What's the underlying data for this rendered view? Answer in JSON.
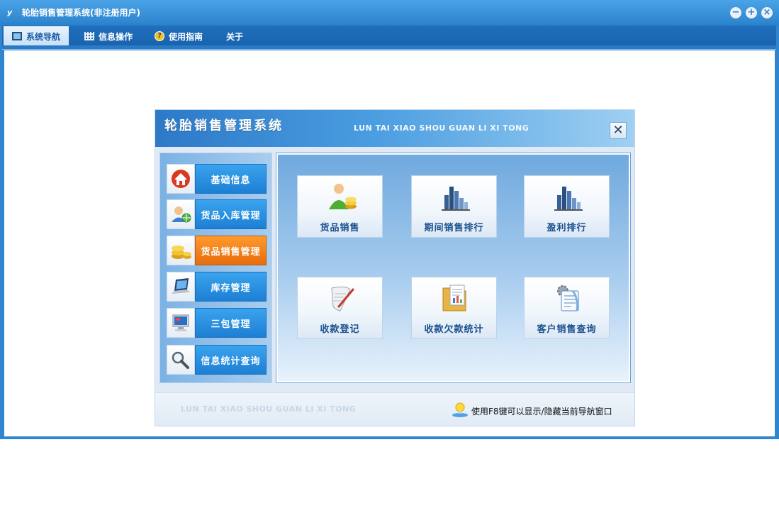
{
  "window": {
    "title": "轮胎销售管理系统(非注册用户)",
    "logo_char": "y",
    "controls": {
      "minimize": "−",
      "restore": "+",
      "close": "×"
    }
  },
  "menu": {
    "tabs": [
      {
        "label": "系统导航",
        "icon": "screen-icon",
        "active": true
      },
      {
        "label": "信息操作",
        "icon": "grid-icon",
        "active": false
      },
      {
        "label": "使用指南",
        "icon": "help-icon",
        "active": false
      },
      {
        "label": "关于",
        "icon": "",
        "active": false
      }
    ]
  },
  "nav": {
    "title": "轮胎销售管理系统",
    "subtitle": "LUN TAI XIAO SHOU GUAN LI XI TONG",
    "close_symbol": "✕",
    "side_items": [
      {
        "label": "基础信息",
        "icon": "home-icon",
        "active": false
      },
      {
        "label": "货品入库管理",
        "icon": "user-network-icon",
        "active": false
      },
      {
        "label": "货品销售管理",
        "icon": "coins-icon",
        "active": true
      },
      {
        "label": "库存管理",
        "icon": "laptop-icon",
        "active": false
      },
      {
        "label": "三包管理",
        "icon": "computer-icon",
        "active": false
      },
      {
        "label": "信息统计查询",
        "icon": "magnifier-icon",
        "active": false
      }
    ],
    "functions": [
      {
        "label": "货品销售",
        "icon": "users-coins-icon"
      },
      {
        "label": "期间销售排行",
        "icon": "bar-chart-icon"
      },
      {
        "label": "盈利排行",
        "icon": "bar-chart-icon"
      },
      {
        "label": "收款登记",
        "icon": "scroll-pen-icon"
      },
      {
        "label": "收款欠款统计",
        "icon": "folder-report-icon"
      },
      {
        "label": "客户销售查询",
        "icon": "document-gear-icon"
      }
    ],
    "footer_watermark": "LUN TAI XIAO SHOU GUAN LI XI TONG",
    "footer_hint": "使用F8键可以显示/隐藏当前导航窗口"
  },
  "colors": {
    "title_bar": "#2f86cf",
    "menu_bar": "#1f6fbe",
    "active_side": "#e76c0d",
    "side_label": "#1d7fd4",
    "function_label": "#1a4f8e"
  }
}
